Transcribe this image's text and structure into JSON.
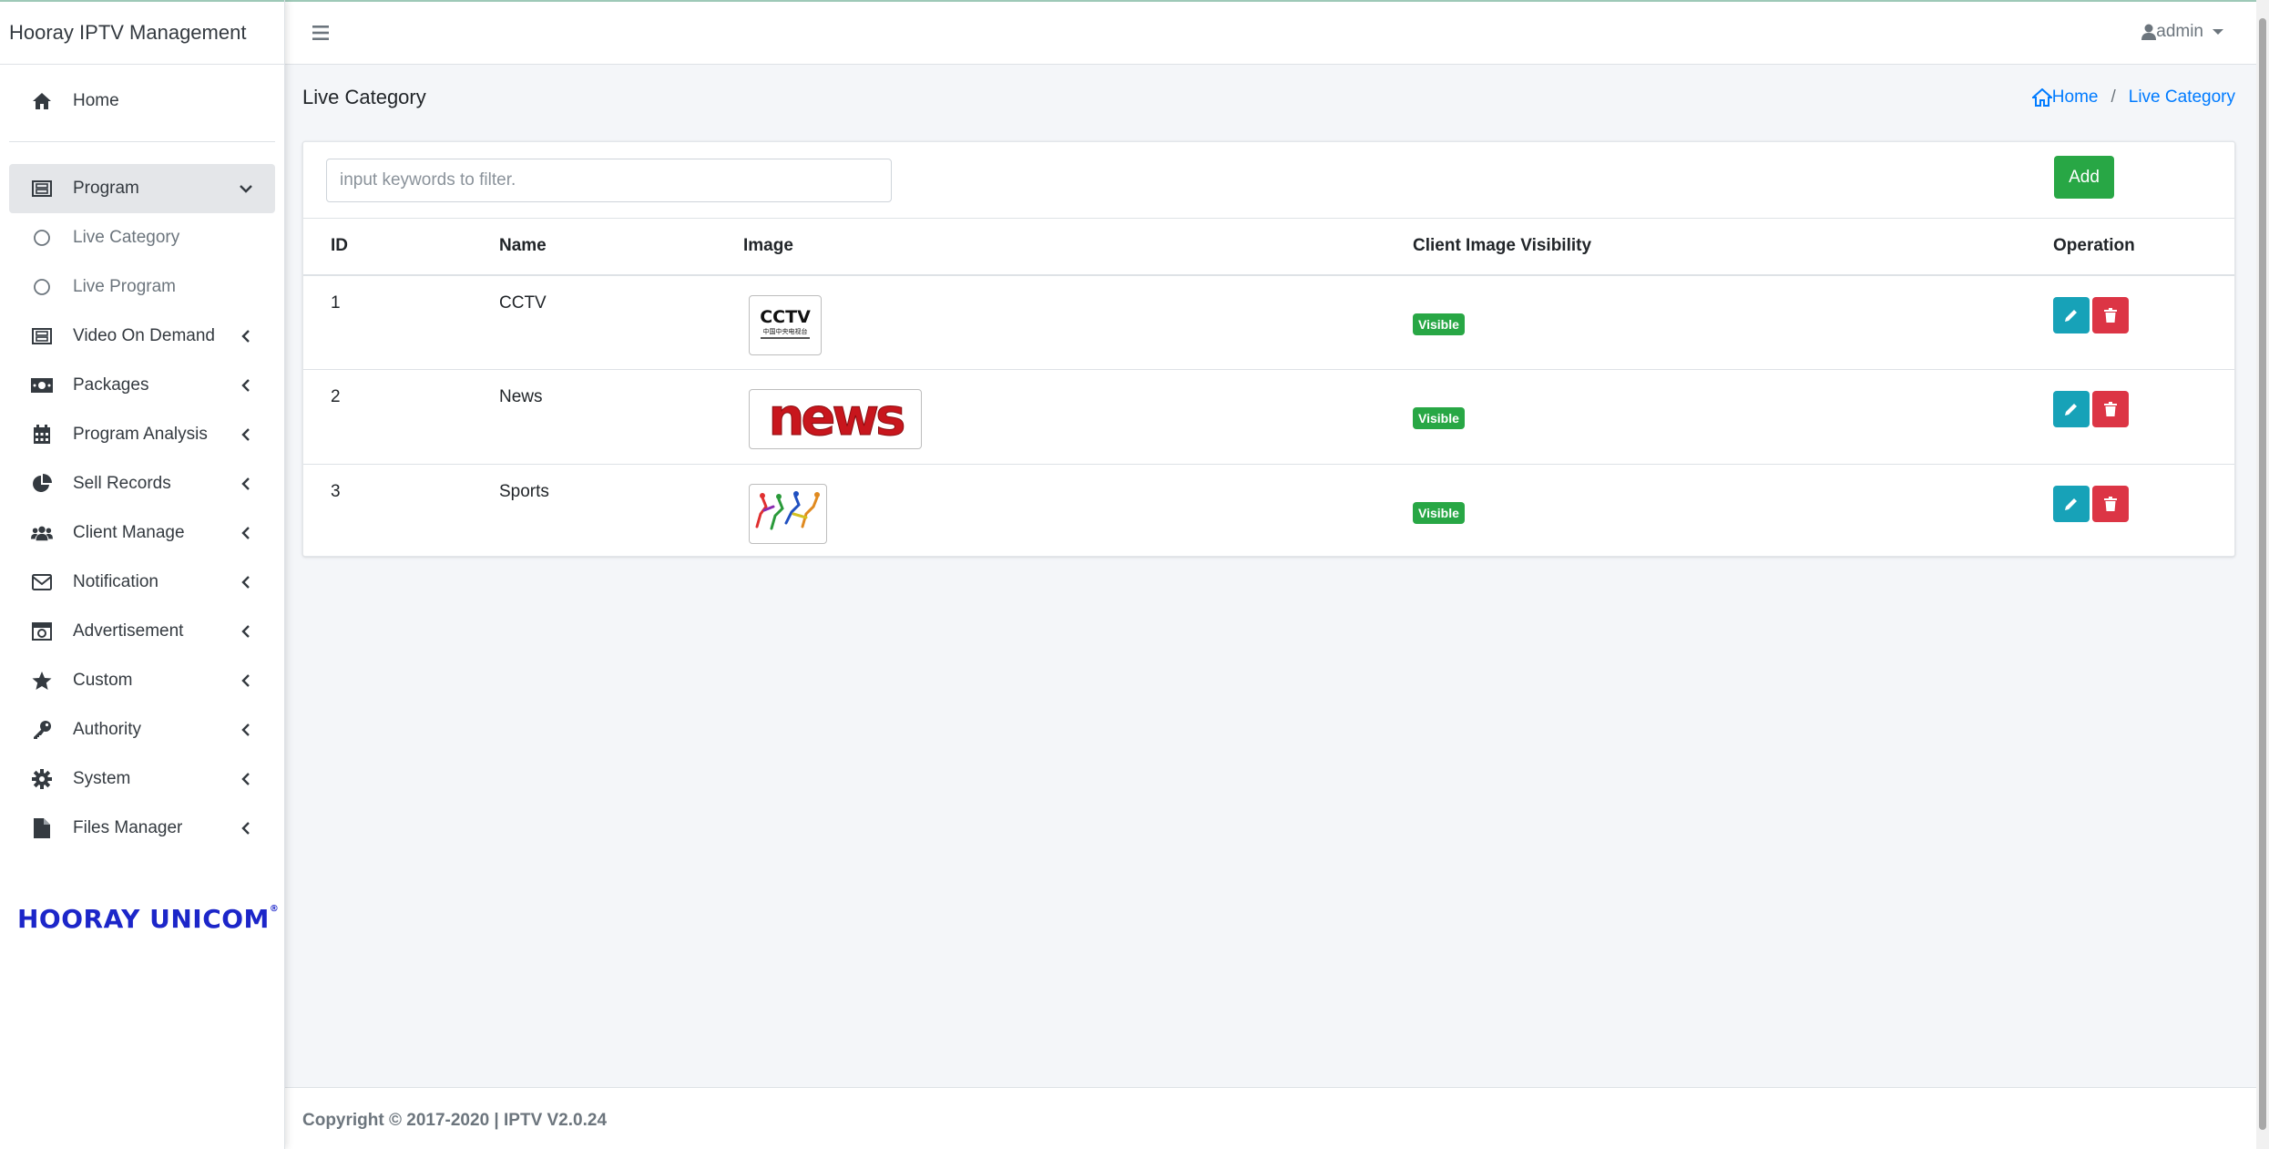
{
  "app": {
    "title": "Hooray IPTV Management",
    "logo_text": "HOORAY UNICOM",
    "logo_mark": "®"
  },
  "sidebar": {
    "home": "Home",
    "items": [
      {
        "label": "Program",
        "icon": "film-icon",
        "expanded": true
      },
      {
        "label": "Live Category",
        "icon": "circle-icon",
        "sub": true
      },
      {
        "label": "Live Program",
        "icon": "circle-icon",
        "sub": true
      },
      {
        "label": "Video On Demand",
        "icon": "film-icon"
      },
      {
        "label": "Packages",
        "icon": "money-icon"
      },
      {
        "label": "Program Analysis",
        "icon": "calendar-icon"
      },
      {
        "label": "Sell Records",
        "icon": "pie-chart-icon"
      },
      {
        "label": "Client Manage",
        "icon": "users-icon"
      },
      {
        "label": "Notification",
        "icon": "envelope-icon"
      },
      {
        "label": "Advertisement",
        "icon": "camera-icon"
      },
      {
        "label": "Custom",
        "icon": "star-icon"
      },
      {
        "label": "Authority",
        "icon": "key-icon"
      },
      {
        "label": "System",
        "icon": "gear-icon"
      },
      {
        "label": "Files Manager",
        "icon": "file-icon"
      }
    ]
  },
  "topbar": {
    "user": "admin"
  },
  "page": {
    "title": "Live Category",
    "breadcrumb": {
      "home": "Home",
      "current": "Live Category"
    }
  },
  "filter": {
    "placeholder": "input keywords to filter."
  },
  "add_label": "Add",
  "table": {
    "headers": {
      "id": "ID",
      "name": "Name",
      "image": "Image",
      "visibility": "Client Image Visibility",
      "operation": "Operation"
    },
    "rows": [
      {
        "id": "1",
        "name": "CCTV",
        "image_text": "CCTV",
        "image_subtext": "中国中央电视台",
        "visibility": "Visible"
      },
      {
        "id": "2",
        "name": "News",
        "image_text": "news",
        "visibility": "Visible"
      },
      {
        "id": "3",
        "name": "Sports",
        "visibility": "Visible"
      }
    ]
  },
  "footer": {
    "text": "Copyright © 2017-2020 | IPTV V2.0.24"
  },
  "colors": {
    "primary": "#007bff",
    "success": "#28a745",
    "info": "#17a2b8",
    "danger": "#dc3545",
    "logo": "#1c26c9"
  }
}
